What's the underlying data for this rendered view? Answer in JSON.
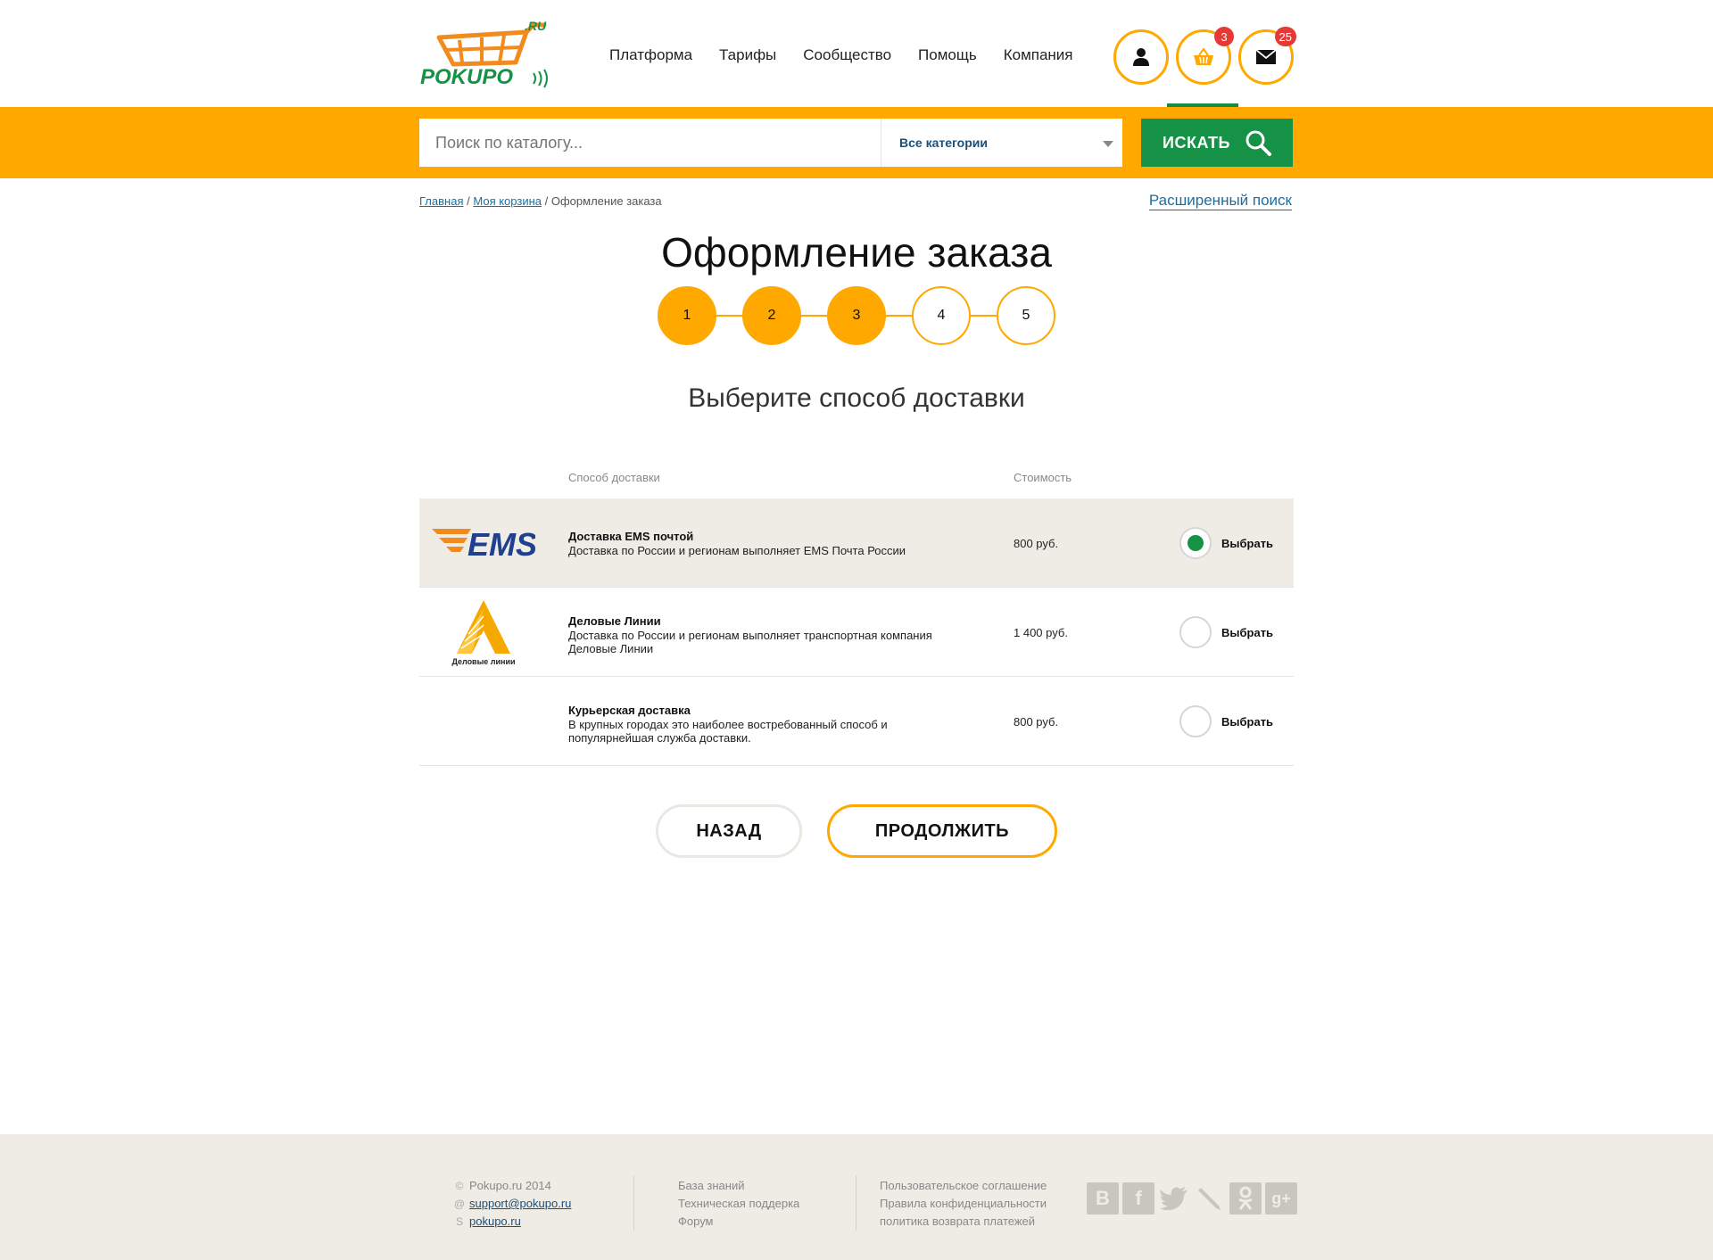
{
  "header": {
    "logo_text": "POKUPO",
    "logo_suffix": ".RU",
    "nav": [
      "Платформа",
      "Тарифы",
      "Сообщество",
      "Помощь",
      "Компания"
    ],
    "cart_count": "3",
    "messages_count": "25"
  },
  "search": {
    "placeholder": "Поиск по каталогу...",
    "category": "Все категории",
    "button": "ИСКАТЬ"
  },
  "breadcrumb": {
    "home": "Главная",
    "sep1": "/",
    "cart": "Моя корзина",
    "sep2": "/",
    "current": "Оформление заказа"
  },
  "advanced_search": "Расширенный поиск",
  "page_title": "Оформление заказа",
  "steps": [
    "1",
    "2",
    "3",
    "4",
    "5"
  ],
  "steps_completed": 3,
  "subtitle": "Выберите способ доставки",
  "table": {
    "col_method": "Способ доставки",
    "col_cost": "Стоимость",
    "rows": [
      {
        "logo": "EMS",
        "name": "Доставка EMS почтой",
        "desc": "Доставка по России и регионам выполняет EMS Почта России",
        "price": "800 руб.",
        "choose": "Выбрать",
        "selected": true
      },
      {
        "logo": "Деловые линии",
        "name": "Деловые Линии",
        "desc": "Доставка по России и регионам выполняет транспортная компания Деловые Линии",
        "price": "1 400 руб.",
        "choose": "Выбрать",
        "selected": false
      },
      {
        "logo": "",
        "name": "Курьерская доставка",
        "desc": "В крупных городах это наиболее востребованный способ и популярнейшая служба доставки.",
        "price": "800 руб.",
        "choose": "Выбрать",
        "selected": false
      }
    ]
  },
  "buttons": {
    "back": "НАЗАД",
    "next": "ПРОДОЛЖИТЬ"
  },
  "footer": {
    "copyright": "Pokupo.ru 2014",
    "email": "support@pokupo.ru",
    "skype": "pokupo.ru",
    "col2": [
      "База знаний",
      "Техническая поддерка",
      "Форум"
    ],
    "col3": [
      "Пользовательское соглашение",
      "Правила конфиденциальности",
      "политика возврата платежей"
    ],
    "social": [
      "vk",
      "facebook",
      "twitter",
      "livejournal",
      "odnoklassniki",
      "google-plus"
    ]
  },
  "colors": {
    "accent": "#ffa800",
    "green": "#159246",
    "link": "#1b6fa0",
    "footer_bg": "#efece6",
    "badge": "#e53935"
  }
}
